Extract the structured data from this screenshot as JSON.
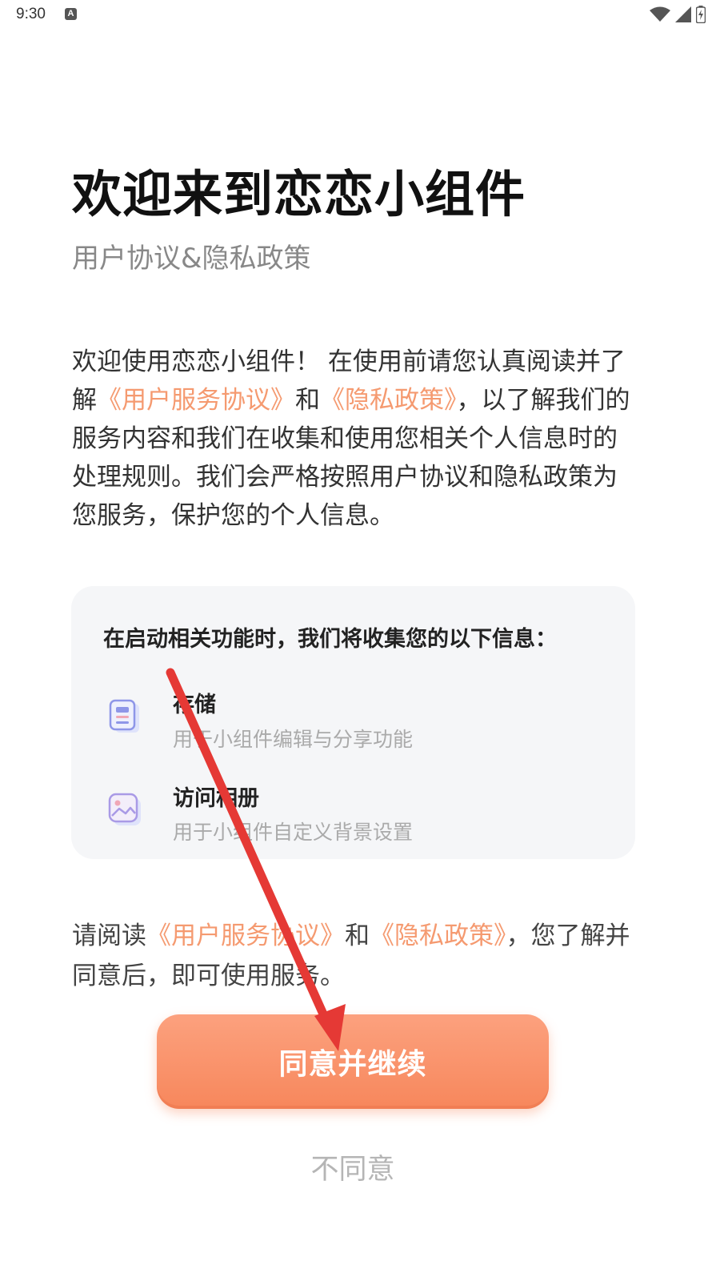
{
  "status_bar": {
    "time": "9:30",
    "notification_badge": "A",
    "icons": [
      "wifi-icon",
      "signal-icon",
      "battery-charging-icon"
    ]
  },
  "header": {
    "title": "欢迎来到恋恋小组件",
    "subtitle": "用户协议&隐私政策"
  },
  "intro": {
    "text_1": "欢迎使用恋恋小组件！ 在使用前请您认真阅读并了解",
    "link_terms": "《用户服务协议》",
    "text_2": "和",
    "link_privacy": "《隐私政策》",
    "text_3": "，以了解我们的服务内容和我们在收集和使用您相关个人信息时的处理规则。我们会严格按照用户协议和隐私政策为您服务，保护您的个人信息。"
  },
  "info_card": {
    "heading": "在启动相关功能时，我们将收集您的以下信息：",
    "permissions": [
      {
        "icon": "storage-document-icon",
        "title": "存储",
        "desc": "用于小组件编辑与分享功能"
      },
      {
        "icon": "photo-album-icon",
        "title": "访问相册",
        "desc": "用于小组件自定义背景设置"
      }
    ]
  },
  "consent": {
    "text_1": "请阅读",
    "link_terms": "《用户服务协议》",
    "text_2": "和",
    "link_privacy": "《隐私政策》",
    "text_3": "，您了解并同意后，即可使用服务。"
  },
  "actions": {
    "agree_label": "同意并继续",
    "disagree_label": "不同意"
  },
  "colors": {
    "accent": "#f7875c",
    "link": "#f59a70",
    "annotation_arrow": "#e53935"
  }
}
